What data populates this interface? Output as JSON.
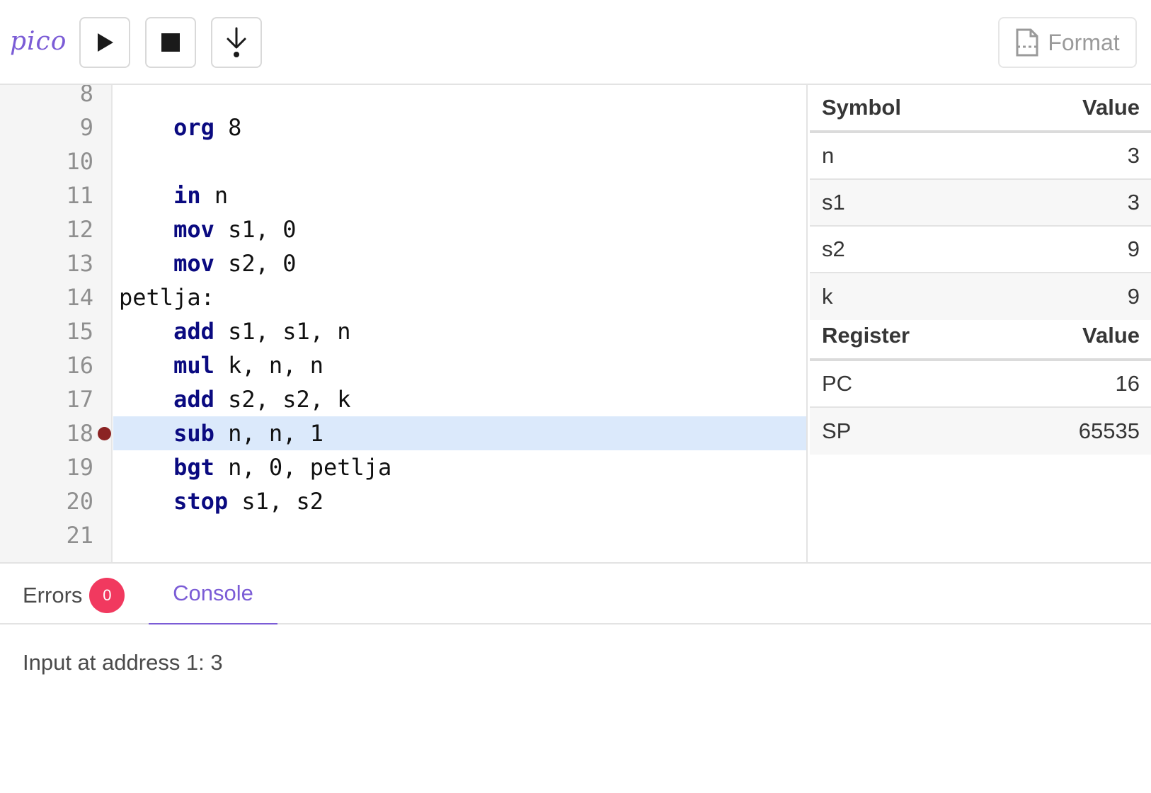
{
  "app": {
    "logo": "pico"
  },
  "toolbar": {
    "run_icon": "play-icon",
    "stop_icon": "stop-icon",
    "step_icon": "step-down-icon",
    "format_label": "Format",
    "format_icon": "format-document-icon"
  },
  "editor": {
    "active_line": 18,
    "breakpoint_line": 18,
    "lines": [
      {
        "n": "8",
        "indent": "",
        "kw": "",
        "rest": ""
      },
      {
        "n": "9",
        "indent": "    ",
        "kw": "org",
        "rest": " 8"
      },
      {
        "n": "10",
        "indent": "",
        "kw": "",
        "rest": ""
      },
      {
        "n": "11",
        "indent": "    ",
        "kw": "in",
        "rest": " n"
      },
      {
        "n": "12",
        "indent": "    ",
        "kw": "mov",
        "rest": " s1, 0"
      },
      {
        "n": "13",
        "indent": "    ",
        "kw": "mov",
        "rest": " s2, 0"
      },
      {
        "n": "14",
        "indent": "",
        "kw": "",
        "rest": "petlja:"
      },
      {
        "n": "15",
        "indent": "    ",
        "kw": "add",
        "rest": " s1, s1, n"
      },
      {
        "n": "16",
        "indent": "    ",
        "kw": "mul",
        "rest": " k, n, n"
      },
      {
        "n": "17",
        "indent": "    ",
        "kw": "add",
        "rest": " s2, s2, k"
      },
      {
        "n": "18",
        "indent": "    ",
        "kw": "sub",
        "rest": " n, n, 1"
      },
      {
        "n": "19",
        "indent": "    ",
        "kw": "bgt",
        "rest": " n, 0, petlja"
      },
      {
        "n": "20",
        "indent": "    ",
        "kw": "stop",
        "rest": " s1, s2"
      },
      {
        "n": "21",
        "indent": "",
        "kw": "",
        "rest": ""
      }
    ]
  },
  "symbols": {
    "header": {
      "name": "Symbol",
      "value": "Value"
    },
    "rows": [
      {
        "name": "n",
        "value": "3"
      },
      {
        "name": "s1",
        "value": "3"
      },
      {
        "name": "s2",
        "value": "9"
      },
      {
        "name": "k",
        "value": "9"
      }
    ]
  },
  "registers": {
    "header": {
      "name": "Register",
      "value": "Value"
    },
    "rows": [
      {
        "name": "PC",
        "value": "16"
      },
      {
        "name": "SP",
        "value": "65535"
      }
    ]
  },
  "tabs": {
    "errors_label": "Errors",
    "errors_count": "0",
    "console_label": "Console"
  },
  "console": {
    "output": "Input at address 1: 3"
  },
  "colors": {
    "accent": "#7b5cd6",
    "keyword": "#0a0a80",
    "active_line": "#dbe9fb",
    "breakpoint": "#8b2323",
    "badge": "#f1395f"
  }
}
